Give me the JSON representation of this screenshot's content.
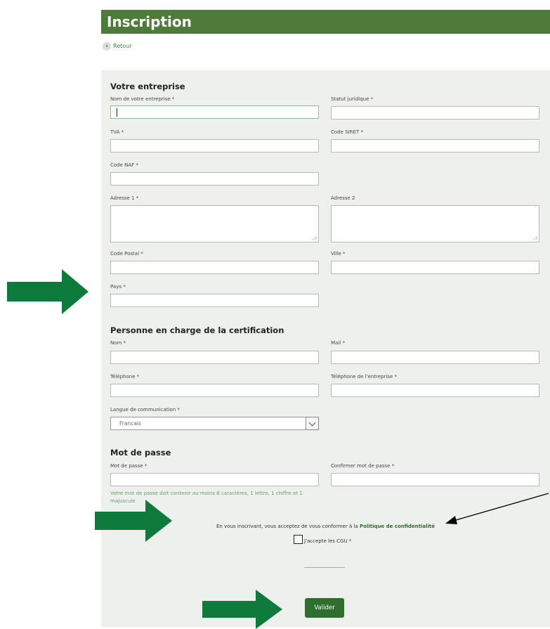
{
  "header": {
    "title": "Inscription"
  },
  "back": {
    "label": "Retour"
  },
  "company": {
    "section_title": "Votre entreprise",
    "company_name_label": "Nom de votre entreprise *",
    "legal_status_label": "Statut juridique *",
    "vat_label": "TVA *",
    "siret_label": "Code SIRET *",
    "naf_label": "Code NAF *",
    "address1_label": "Adresse 1 *",
    "address2_label": "Adresse 2",
    "postal_code_label": "Code Postal *",
    "city_label": "Ville *",
    "country_label": "Pays *"
  },
  "contact": {
    "section_title": "Personne en charge de la certification",
    "last_name_label": "Nom *",
    "mail_label": "Mail *",
    "phone_label": "Téléphone *",
    "company_phone_label": "Téléphone de l'entreprise *",
    "language_label": "Langue de communication *",
    "language_value": "Francais"
  },
  "password": {
    "section_title": "Mot de passe",
    "password_label": "Mot de passe *",
    "confirm_label": "Confirmer mot de passe *",
    "hint": "Votre mot de passe doit contenir au moins 8 caractères, 1 lettre, 1 chiffre et 1 majuscule"
  },
  "consent": {
    "text": "En vous inscrivant, vous acceptez de vous conformer à la ",
    "link": "Politique de confidentialité",
    "cgu_label": "J'accepte les CGU *"
  },
  "submit": {
    "label": "Valider"
  },
  "colors": {
    "header": "#4e7a3a",
    "accent": "#2e6e2e",
    "annotation_arrow": "#0e7a3c"
  }
}
